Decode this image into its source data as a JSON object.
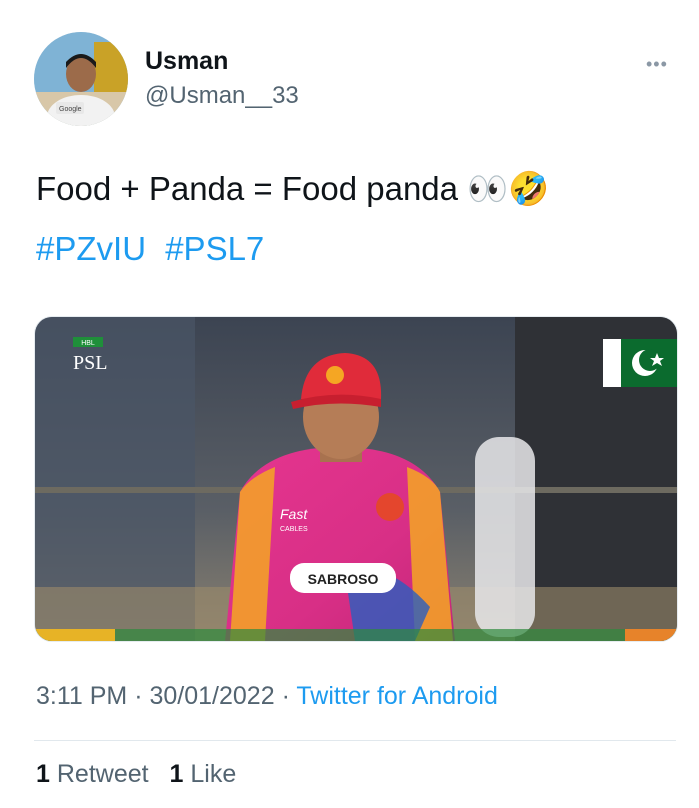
{
  "author": {
    "name": "Usman",
    "handle": "@Usman__33"
  },
  "tweet": {
    "text": "Food + Panda = Food panda 👀🤣",
    "hashtags": [
      "#PZvIU",
      "#PSL7"
    ]
  },
  "media": {
    "broadcast_logo_small": "HBL",
    "broadcast_logo": "PSL",
    "jersey_sponsor": "SABROSO",
    "jersey_brand": "Fast",
    "jersey_brand_sub": "CABLES"
  },
  "meta": {
    "time": "3:11 PM",
    "date": "30/01/2022",
    "source": "Twitter for Android"
  },
  "stats": {
    "retweets_count": "1",
    "retweets_label": "Retweet",
    "likes_count": "1",
    "likes_label": "Like"
  },
  "icons": {
    "more": "more-horizontal-icon"
  },
  "colors": {
    "link": "#1d9bf0",
    "secondary_text": "#536471",
    "primary_text": "#0f1419"
  }
}
